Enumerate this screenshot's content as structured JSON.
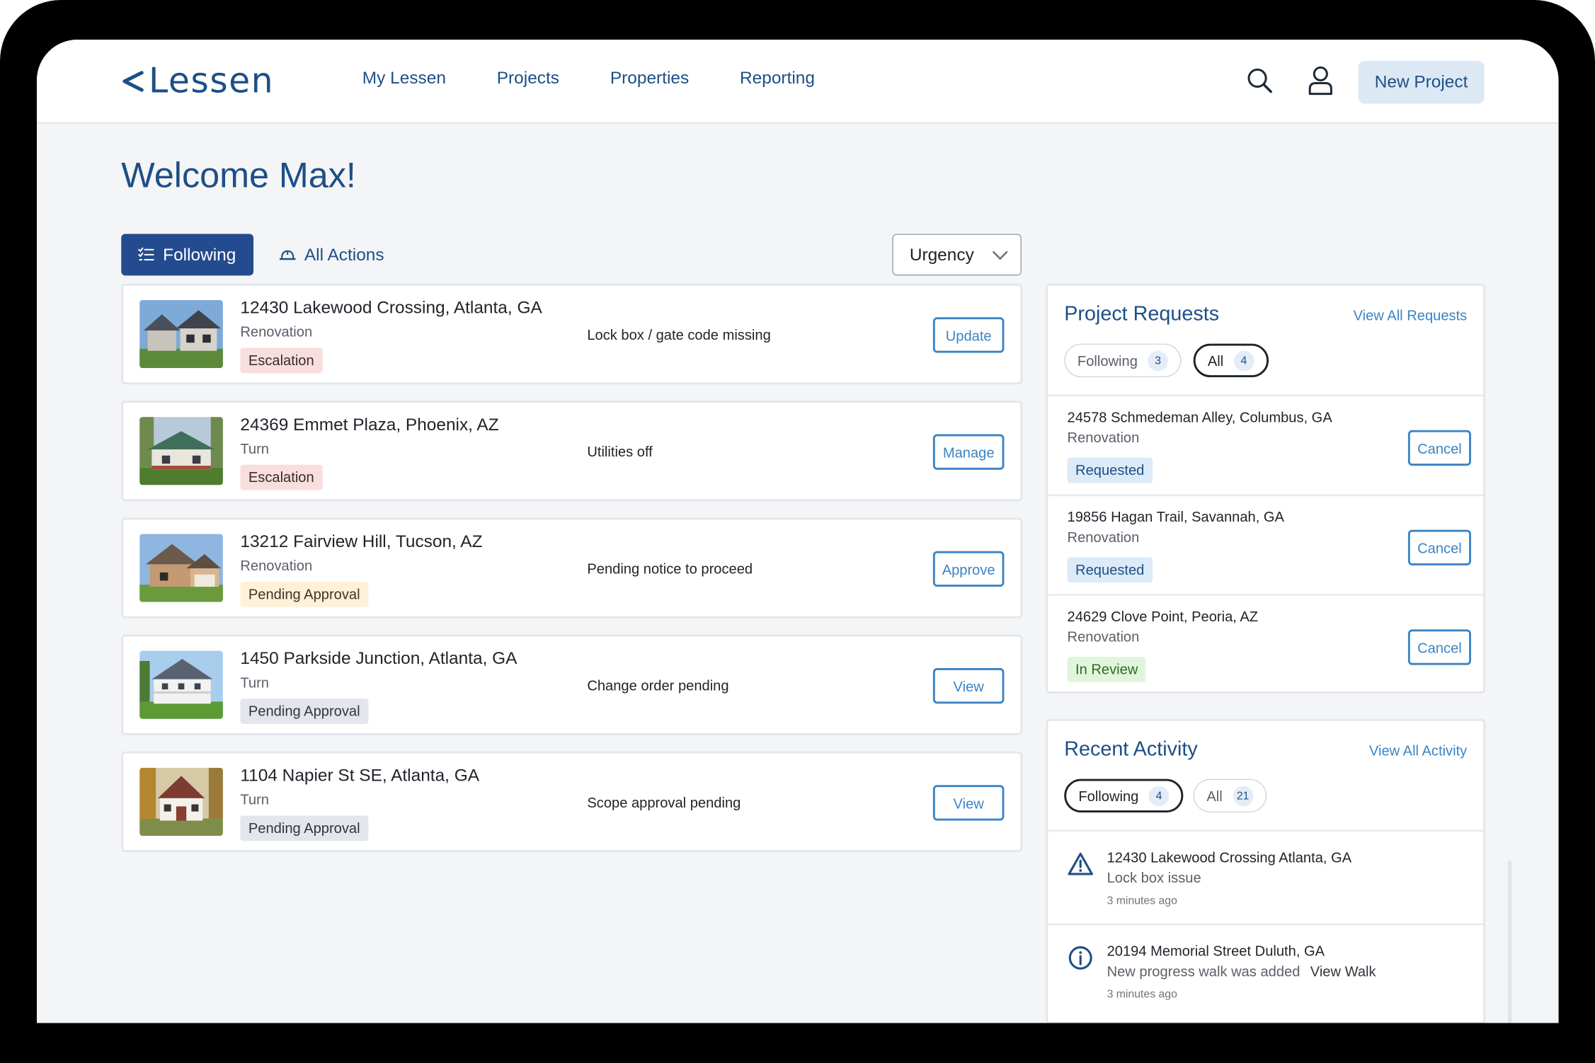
{
  "brand": {
    "logo_text": "Lessen"
  },
  "nav": {
    "links": [
      "My Lessen",
      "Projects",
      "Properties",
      "Reporting"
    ],
    "new_project": "New Project"
  },
  "welcome": "Welcome Max!",
  "filters": {
    "following": "Following",
    "all_actions": "All Actions",
    "sort": "Urgency"
  },
  "projects": [
    {
      "address": "12430 Lakewood Crossing, Atlanta, GA",
      "type": "Renovation",
      "status": "Escalation",
      "issue": "Lock box / gate code missing",
      "action": "Update"
    },
    {
      "address": "24369 Emmet Plaza, Phoenix, AZ",
      "type": "Turn",
      "status": "Escalation",
      "issue": "Utilities off",
      "action": "Manage"
    },
    {
      "address": "13212 Fairview Hill, Tucson, AZ",
      "type": "Renovation",
      "status": "Pending Approval",
      "issue": "Pending notice to proceed",
      "action": "Approve"
    },
    {
      "address": "1450 Parkside Junction, Atlanta, GA",
      "type": "Turn",
      "status": "Pending Approval",
      "issue": "Change order pending",
      "action": "View"
    },
    {
      "address": "1104 Napier St SE, Atlanta, GA",
      "type": "Turn",
      "status": "Pending Approval",
      "issue": "Scope approval pending",
      "action": "View"
    }
  ],
  "requests": {
    "title": "Project Requests",
    "link": "View All Requests",
    "tabs": [
      {
        "label": "Following",
        "count": "3"
      },
      {
        "label": "All",
        "count": "4"
      }
    ],
    "items": [
      {
        "address": "24578 Schmedeman Alley, Columbus, GA",
        "type": "Renovation",
        "status": "Requested",
        "action": "Cancel"
      },
      {
        "address": "19856 Hagan Trail, Savannah, GA",
        "type": "Renovation",
        "status": "Requested",
        "action": "Cancel"
      },
      {
        "address": "24629 Clove Point, Peoria, AZ",
        "type": "Renovation",
        "status": "In Review",
        "action": "Cancel"
      }
    ]
  },
  "activity": {
    "title": "Recent Activity",
    "link": "View All Activity",
    "tabs": [
      {
        "label": "Following",
        "count": "4"
      },
      {
        "label": "All",
        "count": "21"
      }
    ],
    "items": [
      {
        "icon": "warning-icon",
        "address": "12430 Lakewood Crossing Atlanta, GA",
        "desc": "Lock box issue",
        "link": "",
        "time": "3 minutes ago"
      },
      {
        "icon": "info-icon",
        "address": "20194 Memorial Street Duluth, GA",
        "desc": "New progress walk was added",
        "link": "View Walk",
        "time": "3 minutes ago"
      }
    ]
  },
  "colors": {
    "primary": "#1d4f86",
    "accent": "#3a84c3",
    "following_tab_bg": "#244b8f",
    "escalation_bg": "#f9dede",
    "requested_bg": "#dcebf7",
    "review_bg": "#e1f5dc"
  }
}
